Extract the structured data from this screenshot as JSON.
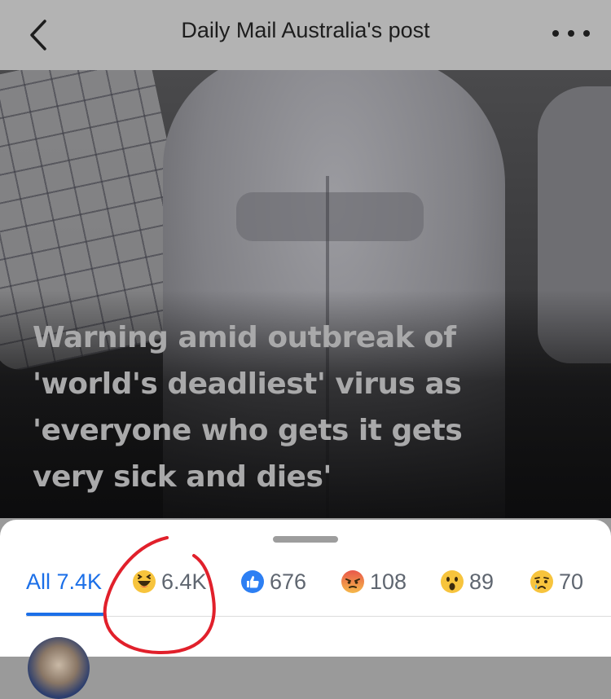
{
  "header": {
    "title": "Daily Mail Australia's post",
    "back_icon": "chevron-left-icon",
    "more_icon": "ellipsis-icon"
  },
  "post": {
    "headline_lines": [
      "Warning amid outbreak of",
      "'world's deadliest' virus  as",
      "'everyone who gets it gets",
      "very sick and dies'"
    ]
  },
  "reactions": {
    "tabs": [
      {
        "label": "All 7.4K",
        "icon": "",
        "active": true
      },
      {
        "label": "6.4K",
        "icon": "haha-emoji-icon"
      },
      {
        "label": "676",
        "icon": "like-icon"
      },
      {
        "label": "108",
        "icon": "angry-emoji-icon"
      },
      {
        "label": "89",
        "icon": "wow-emoji-icon"
      },
      {
        "label": "70",
        "icon": "sad-emoji-icon"
      }
    ]
  },
  "colors": {
    "accent": "#1b6fe8",
    "annotation": "#e1202b"
  }
}
